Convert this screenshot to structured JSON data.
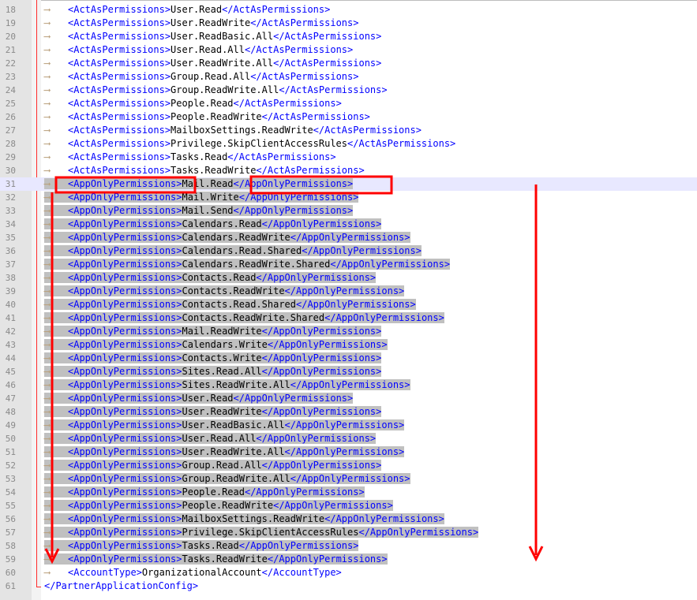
{
  "editor": {
    "tab_arrow": "⟶",
    "lines": [
      {
        "num": "18",
        "indent": true,
        "open": "<ActAsPermissions>",
        "value": "User.Read",
        "close": "</ActAsPermissions>"
      },
      {
        "num": "19",
        "indent": true,
        "open": "<ActAsPermissions>",
        "value": "User.ReadWrite",
        "close": "</ActAsPermissions>"
      },
      {
        "num": "20",
        "indent": true,
        "open": "<ActAsPermissions>",
        "value": "User.ReadBasic.All",
        "close": "</ActAsPermissions>"
      },
      {
        "num": "21",
        "indent": true,
        "open": "<ActAsPermissions>",
        "value": "User.Read.All",
        "close": "</ActAsPermissions>"
      },
      {
        "num": "22",
        "indent": true,
        "open": "<ActAsPermissions>",
        "value": "User.ReadWrite.All",
        "close": "</ActAsPermissions>"
      },
      {
        "num": "23",
        "indent": true,
        "open": "<ActAsPermissions>",
        "value": "Group.Read.All",
        "close": "</ActAsPermissions>"
      },
      {
        "num": "24",
        "indent": true,
        "open": "<ActAsPermissions>",
        "value": "Group.ReadWrite.All",
        "close": "</ActAsPermissions>"
      },
      {
        "num": "25",
        "indent": true,
        "open": "<ActAsPermissions>",
        "value": "People.Read",
        "close": "</ActAsPermissions>"
      },
      {
        "num": "26",
        "indent": true,
        "open": "<ActAsPermissions>",
        "value": "People.ReadWrite",
        "close": "</ActAsPermissions>"
      },
      {
        "num": "27",
        "indent": true,
        "open": "<ActAsPermissions>",
        "value": "MailboxSettings.ReadWrite",
        "close": "</ActAsPermissions>"
      },
      {
        "num": "28",
        "indent": true,
        "open": "<ActAsPermissions>",
        "value": "Privilege.SkipClientAccessRules",
        "close": "</ActAsPermissions>"
      },
      {
        "num": "29",
        "indent": true,
        "open": "<ActAsPermissions>",
        "value": "Tasks.Read",
        "close": "</ActAsPermissions>"
      },
      {
        "num": "30",
        "indent": true,
        "open": "<ActAsPermissions>",
        "value": "Tasks.ReadWrite",
        "close": "</ActAsPermissions>"
      },
      {
        "num": "31",
        "indent": true,
        "selected": true,
        "current": true,
        "open": "<AppOnlyPermissions>",
        "value": "Mail.Read",
        "close": "</AppOnlyPermissions>"
      },
      {
        "num": "32",
        "indent": true,
        "selected": true,
        "open": "<AppOnlyPermissions>",
        "value": "Mail.Write",
        "close": "</AppOnlyPermissions>"
      },
      {
        "num": "33",
        "indent": true,
        "selected": true,
        "open": "<AppOnlyPermissions>",
        "value": "Mail.Send",
        "close": "</AppOnlyPermissions>"
      },
      {
        "num": "34",
        "indent": true,
        "selected": true,
        "open": "<AppOnlyPermissions>",
        "value": "Calendars.Read",
        "close": "</AppOnlyPermissions>"
      },
      {
        "num": "35",
        "indent": true,
        "selected": true,
        "open": "<AppOnlyPermissions>",
        "value": "Calendars.ReadWrite",
        "close": "</AppOnlyPermissions>"
      },
      {
        "num": "36",
        "indent": true,
        "selected": true,
        "open": "<AppOnlyPermissions>",
        "value": "Calendars.Read.Shared",
        "close": "</AppOnlyPermissions>"
      },
      {
        "num": "37",
        "indent": true,
        "selected": true,
        "open": "<AppOnlyPermissions>",
        "value": "Calendars.ReadWrite.Shared",
        "close": "</AppOnlyPermissions>"
      },
      {
        "num": "38",
        "indent": true,
        "selected": true,
        "open": "<AppOnlyPermissions>",
        "value": "Contacts.Read",
        "close": "</AppOnlyPermissions>"
      },
      {
        "num": "39",
        "indent": true,
        "selected": true,
        "open": "<AppOnlyPermissions>",
        "value": "Contacts.ReadWrite",
        "close": "</AppOnlyPermissions>"
      },
      {
        "num": "40",
        "indent": true,
        "selected": true,
        "open": "<AppOnlyPermissions>",
        "value": "Contacts.Read.Shared",
        "close": "</AppOnlyPermissions>"
      },
      {
        "num": "41",
        "indent": true,
        "selected": true,
        "open": "<AppOnlyPermissions>",
        "value": "Contacts.ReadWrite.Shared",
        "close": "</AppOnlyPermissions>"
      },
      {
        "num": "42",
        "indent": true,
        "selected": true,
        "open": "<AppOnlyPermissions>",
        "value": "Mail.ReadWrite",
        "close": "</AppOnlyPermissions>"
      },
      {
        "num": "43",
        "indent": true,
        "selected": true,
        "open": "<AppOnlyPermissions>",
        "value": "Calendars.Write",
        "close": "</AppOnlyPermissions>"
      },
      {
        "num": "44",
        "indent": true,
        "selected": true,
        "open": "<AppOnlyPermissions>",
        "value": "Contacts.Write",
        "close": "</AppOnlyPermissions>"
      },
      {
        "num": "45",
        "indent": true,
        "selected": true,
        "open": "<AppOnlyPermissions>",
        "value": "Sites.Read.All",
        "close": "</AppOnlyPermissions>"
      },
      {
        "num": "46",
        "indent": true,
        "selected": true,
        "open": "<AppOnlyPermissions>",
        "value": "Sites.ReadWrite.All",
        "close": "</AppOnlyPermissions>"
      },
      {
        "num": "47",
        "indent": true,
        "selected": true,
        "open": "<AppOnlyPermissions>",
        "value": "User.Read",
        "close": "</AppOnlyPermissions>"
      },
      {
        "num": "48",
        "indent": true,
        "selected": true,
        "open": "<AppOnlyPermissions>",
        "value": "User.ReadWrite",
        "close": "</AppOnlyPermissions>"
      },
      {
        "num": "49",
        "indent": true,
        "selected": true,
        "open": "<AppOnlyPermissions>",
        "value": "User.ReadBasic.All",
        "close": "</AppOnlyPermissions>"
      },
      {
        "num": "50",
        "indent": true,
        "selected": true,
        "open": "<AppOnlyPermissions>",
        "value": "User.Read.All",
        "close": "</AppOnlyPermissions>"
      },
      {
        "num": "51",
        "indent": true,
        "selected": true,
        "open": "<AppOnlyPermissions>",
        "value": "User.ReadWrite.All",
        "close": "</AppOnlyPermissions>"
      },
      {
        "num": "52",
        "indent": true,
        "selected": true,
        "open": "<AppOnlyPermissions>",
        "value": "Group.Read.All",
        "close": "</AppOnlyPermissions>"
      },
      {
        "num": "53",
        "indent": true,
        "selected": true,
        "open": "<AppOnlyPermissions>",
        "value": "Group.ReadWrite.All",
        "close": "</AppOnlyPermissions>"
      },
      {
        "num": "54",
        "indent": true,
        "selected": true,
        "open": "<AppOnlyPermissions>",
        "value": "People.Read",
        "close": "</AppOnlyPermissions>"
      },
      {
        "num": "55",
        "indent": true,
        "selected": true,
        "open": "<AppOnlyPermissions>",
        "value": "People.ReadWrite",
        "close": "</AppOnlyPermissions>"
      },
      {
        "num": "56",
        "indent": true,
        "selected": true,
        "open": "<AppOnlyPermissions>",
        "value": "MailboxSettings.ReadWrite",
        "close": "</AppOnlyPermissions>"
      },
      {
        "num": "57",
        "indent": true,
        "selected": true,
        "open": "<AppOnlyPermissions>",
        "value": "Privilege.SkipClientAccessRules",
        "close": "</AppOnlyPermissions>"
      },
      {
        "num": "58",
        "indent": true,
        "selected": true,
        "open": "<AppOnlyPermissions>",
        "value": "Tasks.Read",
        "close": "</AppOnlyPermissions>"
      },
      {
        "num": "59",
        "indent": true,
        "selected": true,
        "open": "<AppOnlyPermissions>",
        "value": "Tasks.ReadWrite",
        "close": "</AppOnlyPermissions>"
      },
      {
        "num": "60",
        "indent": true,
        "open": "<AccountType>",
        "value": "OrganizationalAccount",
        "close": "</AccountType>"
      },
      {
        "num": "61",
        "indent": false,
        "open": "",
        "value": "",
        "close": "</PartnerApplicationConfig>"
      }
    ]
  },
  "colors": {
    "annotation": "#ff0000",
    "tag": "#0000ff",
    "selection": "#c0c0c0",
    "current_line": "#e8e8ff",
    "tab_arrow": "#b99f7a"
  }
}
